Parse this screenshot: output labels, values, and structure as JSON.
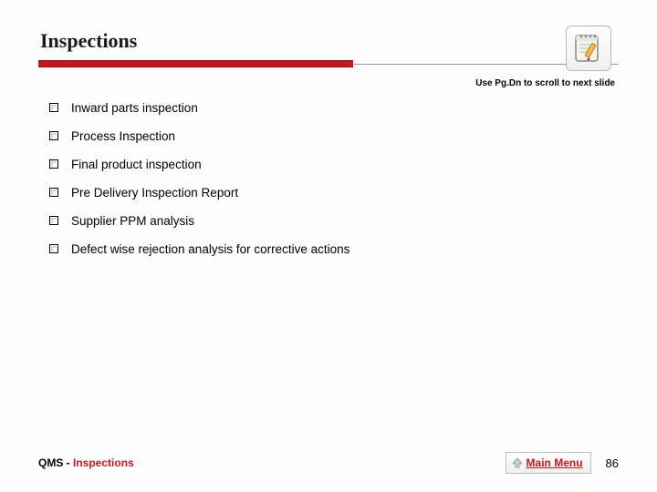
{
  "title": "Inspections",
  "hint": "Use Pg.Dn to scroll to next slide",
  "items": [
    "Inward parts inspection",
    "Process Inspection",
    "Final product inspection",
    "Pre Delivery Inspection Report",
    "Supplier PPM analysis",
    "Defect wise rejection analysis for corrective actions"
  ],
  "footer": {
    "prefix": "QMS",
    "dash": " - ",
    "section": "Inspections",
    "main_menu": "Main Menu",
    "page": "86"
  }
}
